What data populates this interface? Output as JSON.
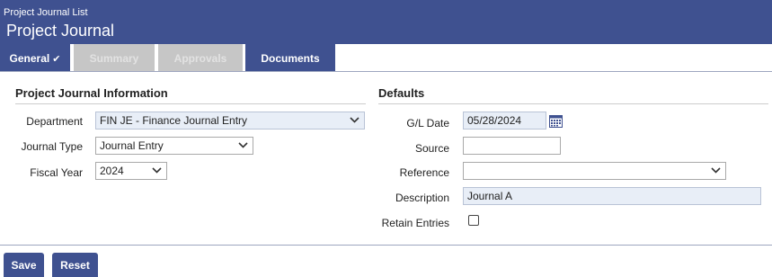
{
  "header": {
    "breadcrumb": "Project Journal List",
    "title": "Project Journal"
  },
  "tabs": [
    {
      "label": "General",
      "state": "active",
      "checked": true
    },
    {
      "label": "Summary",
      "state": "disabled"
    },
    {
      "label": "Approvals",
      "state": "disabled"
    },
    {
      "label": "Documents",
      "state": "enabled"
    }
  ],
  "info": {
    "title": "Project Journal Information",
    "department": {
      "label": "Department",
      "value": "FIN JE - Finance Journal Entry"
    },
    "journal_type": {
      "label": "Journal Type",
      "value": "Journal Entry"
    },
    "fiscal_year": {
      "label": "Fiscal Year",
      "value": "2024"
    }
  },
  "defaults": {
    "title": "Defaults",
    "gl_date": {
      "label": "G/L Date",
      "value": "05/28/2024"
    },
    "source": {
      "label": "Source",
      "value": ""
    },
    "reference": {
      "label": "Reference",
      "value": ""
    },
    "description": {
      "label": "Description",
      "value": "Journal A"
    },
    "retain_entries": {
      "label": "Retain Entries",
      "checked": false
    }
  },
  "buttons": {
    "save": "Save",
    "reset": "Reset"
  },
  "colors": {
    "brand": "#3f5190",
    "tab_disabled": "#c6c6c6"
  }
}
